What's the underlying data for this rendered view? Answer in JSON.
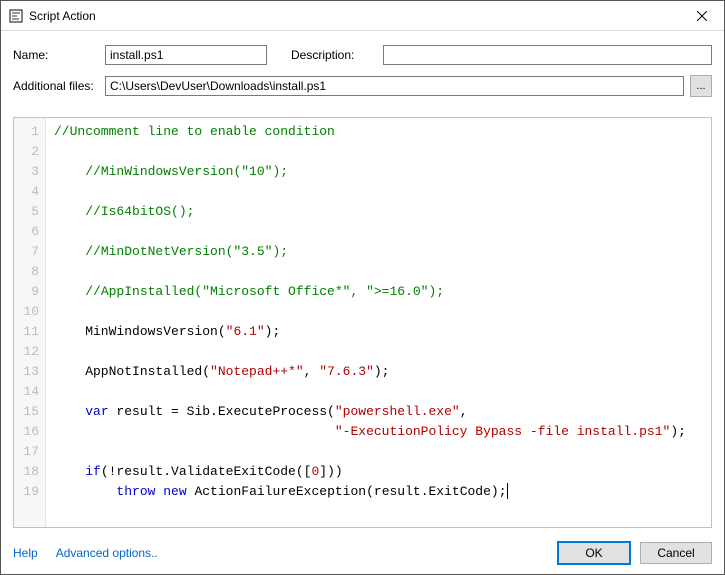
{
  "window": {
    "title": "Script Action"
  },
  "form": {
    "name_label": "Name:",
    "name_value": "install.ps1",
    "desc_label": "Description:",
    "desc_value": "",
    "addfiles_label": "Additional files:",
    "addfiles_value": "C:\\Users\\DevUser\\Downloads\\install.ps1",
    "browse_label": "..."
  },
  "code_lines": [
    {
      "n": 1,
      "spans": [
        {
          "cls": "c",
          "t": "//Uncomment line to enable condition"
        }
      ]
    },
    {
      "n": 2,
      "spans": []
    },
    {
      "n": 3,
      "spans": [
        {
          "cls": "t",
          "t": "    "
        },
        {
          "cls": "c",
          "t": "//MinWindowsVersion(\"10\");"
        }
      ]
    },
    {
      "n": 4,
      "spans": []
    },
    {
      "n": 5,
      "spans": [
        {
          "cls": "t",
          "t": "    "
        },
        {
          "cls": "c",
          "t": "//Is64bitOS();"
        }
      ]
    },
    {
      "n": 6,
      "spans": []
    },
    {
      "n": 7,
      "spans": [
        {
          "cls": "t",
          "t": "    "
        },
        {
          "cls": "c",
          "t": "//MinDotNetVersion(\"3.5\");"
        }
      ]
    },
    {
      "n": 8,
      "spans": []
    },
    {
      "n": 9,
      "spans": [
        {
          "cls": "t",
          "t": "    "
        },
        {
          "cls": "c",
          "t": "//AppInstalled(\"Microsoft Office*\", \">=16.0\");"
        }
      ]
    },
    {
      "n": 10,
      "spans": []
    },
    {
      "n": 11,
      "spans": [
        {
          "cls": "t",
          "t": "    MinWindowsVersion("
        },
        {
          "cls": "s",
          "t": "\"6.1\""
        },
        {
          "cls": "t",
          "t": ");"
        }
      ]
    },
    {
      "n": 12,
      "spans": []
    },
    {
      "n": 13,
      "spans": [
        {
          "cls": "t",
          "t": "    AppNotInstalled("
        },
        {
          "cls": "s",
          "t": "\"Notepad++*\""
        },
        {
          "cls": "t",
          "t": ", "
        },
        {
          "cls": "s",
          "t": "\"7.6.3\""
        },
        {
          "cls": "t",
          "t": ");"
        }
      ]
    },
    {
      "n": 14,
      "spans": []
    },
    {
      "n": 15,
      "spans": [
        {
          "cls": "t",
          "t": "    "
        },
        {
          "cls": "k",
          "t": "var"
        },
        {
          "cls": "t",
          "t": " result = Sib.ExecuteProcess("
        },
        {
          "cls": "s",
          "t": "\"powershell.exe\""
        },
        {
          "cls": "t",
          "t": ","
        }
      ]
    },
    {
      "n": 16,
      "spans": [
        {
          "cls": "t",
          "t": "                                    "
        },
        {
          "cls": "s",
          "t": "\"-ExecutionPolicy Bypass -file install.ps1\""
        },
        {
          "cls": "t",
          "t": ");"
        }
      ]
    },
    {
      "n": 17,
      "spans": []
    },
    {
      "n": 18,
      "spans": [
        {
          "cls": "t",
          "t": "    "
        },
        {
          "cls": "k",
          "t": "if"
        },
        {
          "cls": "t",
          "t": "(!result.ValidateExitCode(["
        },
        {
          "cls": "n",
          "t": "0"
        },
        {
          "cls": "t",
          "t": "]))"
        }
      ]
    },
    {
      "n": 19,
      "spans": [
        {
          "cls": "t",
          "t": "        "
        },
        {
          "cls": "k",
          "t": "throw"
        },
        {
          "cls": "t",
          "t": " "
        },
        {
          "cls": "k",
          "t": "new"
        },
        {
          "cls": "t",
          "t": " ActionFailureException(result.ExitCode);"
        }
      ],
      "caret": true
    }
  ],
  "footer": {
    "help": "Help",
    "adv": "Advanced options..",
    "ok": "OK",
    "cancel": "Cancel"
  }
}
